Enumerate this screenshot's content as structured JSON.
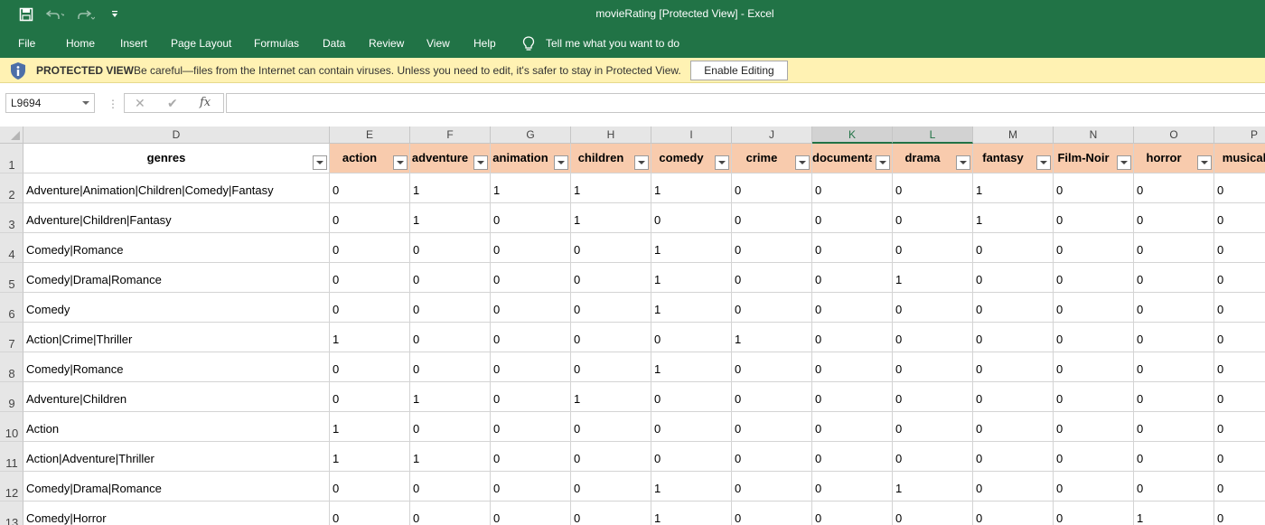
{
  "window": {
    "title": "movieRating  [Protected View]  -  Excel"
  },
  "qat": {
    "save_icon": "save-icon",
    "undo_icon": "undo-icon",
    "redo_icon": "redo-icon",
    "customize_icon": "customize-qat-icon"
  },
  "ribbon": {
    "tabs": [
      "File",
      "Home",
      "Insert",
      "Page Layout",
      "Formulas",
      "Data",
      "Review",
      "View",
      "Help"
    ],
    "tell_me": "Tell me what you want to do"
  },
  "protected_view": {
    "title": "PROTECTED VIEW",
    "message": "Be careful—files from the Internet can contain viruses. Unless you need to edit, it's safer to stay in Protected View.",
    "button": "Enable Editing"
  },
  "formula_bar": {
    "name_box": "L9694",
    "separator": "⋮",
    "cancel": "✕",
    "enter": "✔",
    "fx": "fx",
    "value": ""
  },
  "colors": {
    "excel_green": "#217346",
    "header_fill": "#f8cbad",
    "protected_bar": "#fff2b3"
  },
  "sheet": {
    "column_letters": [
      "D",
      "E",
      "F",
      "G",
      "H",
      "I",
      "J",
      "K",
      "L",
      "M",
      "N",
      "O",
      "P"
    ],
    "selected_columns": [
      "K",
      "L"
    ],
    "headers": [
      "genres",
      "action",
      "adventure",
      "animation",
      "children",
      "comedy",
      "crime",
      "documentary",
      "drama",
      "fantasy",
      "Film-Noir",
      "horror",
      "musical"
    ],
    "row_numbers": [
      "1",
      "2",
      "3",
      "4",
      "5",
      "6",
      "7",
      "8",
      "9",
      "10",
      "11",
      "12",
      "13"
    ],
    "rows": [
      [
        "Adventure|Animation|Children|Comedy|Fantasy",
        "0",
        "1",
        "1",
        "1",
        "1",
        "0",
        "0",
        "0",
        "1",
        "0",
        "0",
        "0"
      ],
      [
        "Adventure|Children|Fantasy",
        "0",
        "1",
        "0",
        "1",
        "0",
        "0",
        "0",
        "0",
        "1",
        "0",
        "0",
        "0"
      ],
      [
        "Comedy|Romance",
        "0",
        "0",
        "0",
        "0",
        "1",
        "0",
        "0",
        "0",
        "0",
        "0",
        "0",
        "0"
      ],
      [
        "Comedy|Drama|Romance",
        "0",
        "0",
        "0",
        "0",
        "1",
        "0",
        "0",
        "1",
        "0",
        "0",
        "0",
        "0"
      ],
      [
        "Comedy",
        "0",
        "0",
        "0",
        "0",
        "1",
        "0",
        "0",
        "0",
        "0",
        "0",
        "0",
        "0"
      ],
      [
        "Action|Crime|Thriller",
        "1",
        "0",
        "0",
        "0",
        "0",
        "1",
        "0",
        "0",
        "0",
        "0",
        "0",
        "0"
      ],
      [
        "Comedy|Romance",
        "0",
        "0",
        "0",
        "0",
        "1",
        "0",
        "0",
        "0",
        "0",
        "0",
        "0",
        "0"
      ],
      [
        "Adventure|Children",
        "0",
        "1",
        "0",
        "1",
        "0",
        "0",
        "0",
        "0",
        "0",
        "0",
        "0",
        "0"
      ],
      [
        "Action",
        "1",
        "0",
        "0",
        "0",
        "0",
        "0",
        "0",
        "0",
        "0",
        "0",
        "0",
        "0"
      ],
      [
        "Action|Adventure|Thriller",
        "1",
        "1",
        "0",
        "0",
        "0",
        "0",
        "0",
        "0",
        "0",
        "0",
        "0",
        "0"
      ],
      [
        "Comedy|Drama|Romance",
        "0",
        "0",
        "0",
        "0",
        "1",
        "0",
        "0",
        "1",
        "0",
        "0",
        "0",
        "0"
      ],
      [
        "Comedy|Horror",
        "0",
        "0",
        "0",
        "0",
        "1",
        "0",
        "0",
        "0",
        "0",
        "0",
        "1",
        "0"
      ]
    ]
  }
}
